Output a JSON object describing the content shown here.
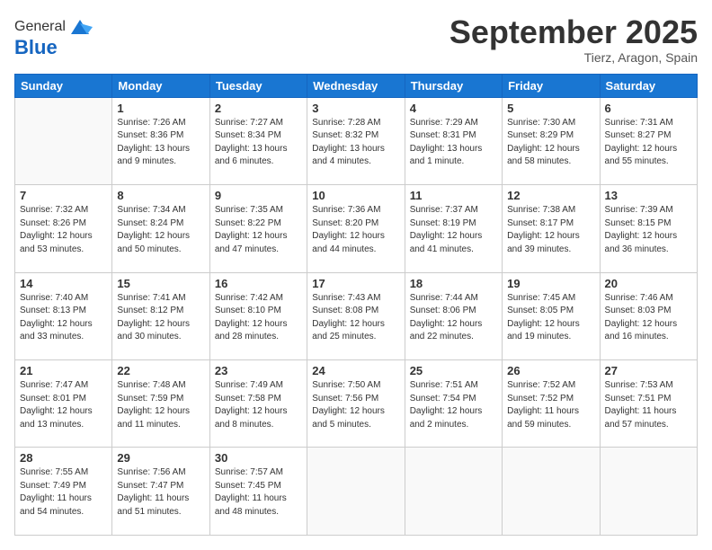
{
  "logo": {
    "general": "General",
    "blue": "Blue"
  },
  "header": {
    "month": "September 2025",
    "location": "Tierz, Aragon, Spain"
  },
  "days_of_week": [
    "Sunday",
    "Monday",
    "Tuesday",
    "Wednesday",
    "Thursday",
    "Friday",
    "Saturday"
  ],
  "weeks": [
    [
      {
        "day": "",
        "sunrise": "",
        "sunset": "",
        "daylight": ""
      },
      {
        "day": "1",
        "sunrise": "Sunrise: 7:26 AM",
        "sunset": "Sunset: 8:36 PM",
        "daylight": "Daylight: 13 hours and 9 minutes."
      },
      {
        "day": "2",
        "sunrise": "Sunrise: 7:27 AM",
        "sunset": "Sunset: 8:34 PM",
        "daylight": "Daylight: 13 hours and 6 minutes."
      },
      {
        "day": "3",
        "sunrise": "Sunrise: 7:28 AM",
        "sunset": "Sunset: 8:32 PM",
        "daylight": "Daylight: 13 hours and 4 minutes."
      },
      {
        "day": "4",
        "sunrise": "Sunrise: 7:29 AM",
        "sunset": "Sunset: 8:31 PM",
        "daylight": "Daylight: 13 hours and 1 minute."
      },
      {
        "day": "5",
        "sunrise": "Sunrise: 7:30 AM",
        "sunset": "Sunset: 8:29 PM",
        "daylight": "Daylight: 12 hours and 58 minutes."
      },
      {
        "day": "6",
        "sunrise": "Sunrise: 7:31 AM",
        "sunset": "Sunset: 8:27 PM",
        "daylight": "Daylight: 12 hours and 55 minutes."
      }
    ],
    [
      {
        "day": "7",
        "sunrise": "Sunrise: 7:32 AM",
        "sunset": "Sunset: 8:26 PM",
        "daylight": "Daylight: 12 hours and 53 minutes."
      },
      {
        "day": "8",
        "sunrise": "Sunrise: 7:34 AM",
        "sunset": "Sunset: 8:24 PM",
        "daylight": "Daylight: 12 hours and 50 minutes."
      },
      {
        "day": "9",
        "sunrise": "Sunrise: 7:35 AM",
        "sunset": "Sunset: 8:22 PM",
        "daylight": "Daylight: 12 hours and 47 minutes."
      },
      {
        "day": "10",
        "sunrise": "Sunrise: 7:36 AM",
        "sunset": "Sunset: 8:20 PM",
        "daylight": "Daylight: 12 hours and 44 minutes."
      },
      {
        "day": "11",
        "sunrise": "Sunrise: 7:37 AM",
        "sunset": "Sunset: 8:19 PM",
        "daylight": "Daylight: 12 hours and 41 minutes."
      },
      {
        "day": "12",
        "sunrise": "Sunrise: 7:38 AM",
        "sunset": "Sunset: 8:17 PM",
        "daylight": "Daylight: 12 hours and 39 minutes."
      },
      {
        "day": "13",
        "sunrise": "Sunrise: 7:39 AM",
        "sunset": "Sunset: 8:15 PM",
        "daylight": "Daylight: 12 hours and 36 minutes."
      }
    ],
    [
      {
        "day": "14",
        "sunrise": "Sunrise: 7:40 AM",
        "sunset": "Sunset: 8:13 PM",
        "daylight": "Daylight: 12 hours and 33 minutes."
      },
      {
        "day": "15",
        "sunrise": "Sunrise: 7:41 AM",
        "sunset": "Sunset: 8:12 PM",
        "daylight": "Daylight: 12 hours and 30 minutes."
      },
      {
        "day": "16",
        "sunrise": "Sunrise: 7:42 AM",
        "sunset": "Sunset: 8:10 PM",
        "daylight": "Daylight: 12 hours and 28 minutes."
      },
      {
        "day": "17",
        "sunrise": "Sunrise: 7:43 AM",
        "sunset": "Sunset: 8:08 PM",
        "daylight": "Daylight: 12 hours and 25 minutes."
      },
      {
        "day": "18",
        "sunrise": "Sunrise: 7:44 AM",
        "sunset": "Sunset: 8:06 PM",
        "daylight": "Daylight: 12 hours and 22 minutes."
      },
      {
        "day": "19",
        "sunrise": "Sunrise: 7:45 AM",
        "sunset": "Sunset: 8:05 PM",
        "daylight": "Daylight: 12 hours and 19 minutes."
      },
      {
        "day": "20",
        "sunrise": "Sunrise: 7:46 AM",
        "sunset": "Sunset: 8:03 PM",
        "daylight": "Daylight: 12 hours and 16 minutes."
      }
    ],
    [
      {
        "day": "21",
        "sunrise": "Sunrise: 7:47 AM",
        "sunset": "Sunset: 8:01 PM",
        "daylight": "Daylight: 12 hours and 13 minutes."
      },
      {
        "day": "22",
        "sunrise": "Sunrise: 7:48 AM",
        "sunset": "Sunset: 7:59 PM",
        "daylight": "Daylight: 12 hours and 11 minutes."
      },
      {
        "day": "23",
        "sunrise": "Sunrise: 7:49 AM",
        "sunset": "Sunset: 7:58 PM",
        "daylight": "Daylight: 12 hours and 8 minutes."
      },
      {
        "day": "24",
        "sunrise": "Sunrise: 7:50 AM",
        "sunset": "Sunset: 7:56 PM",
        "daylight": "Daylight: 12 hours and 5 minutes."
      },
      {
        "day": "25",
        "sunrise": "Sunrise: 7:51 AM",
        "sunset": "Sunset: 7:54 PM",
        "daylight": "Daylight: 12 hours and 2 minutes."
      },
      {
        "day": "26",
        "sunrise": "Sunrise: 7:52 AM",
        "sunset": "Sunset: 7:52 PM",
        "daylight": "Daylight: 11 hours and 59 minutes."
      },
      {
        "day": "27",
        "sunrise": "Sunrise: 7:53 AM",
        "sunset": "Sunset: 7:51 PM",
        "daylight": "Daylight: 11 hours and 57 minutes."
      }
    ],
    [
      {
        "day": "28",
        "sunrise": "Sunrise: 7:55 AM",
        "sunset": "Sunset: 7:49 PM",
        "daylight": "Daylight: 11 hours and 54 minutes."
      },
      {
        "day": "29",
        "sunrise": "Sunrise: 7:56 AM",
        "sunset": "Sunset: 7:47 PM",
        "daylight": "Daylight: 11 hours and 51 minutes."
      },
      {
        "day": "30",
        "sunrise": "Sunrise: 7:57 AM",
        "sunset": "Sunset: 7:45 PM",
        "daylight": "Daylight: 11 hours and 48 minutes."
      },
      {
        "day": "",
        "sunrise": "",
        "sunset": "",
        "daylight": ""
      },
      {
        "day": "",
        "sunrise": "",
        "sunset": "",
        "daylight": ""
      },
      {
        "day": "",
        "sunrise": "",
        "sunset": "",
        "daylight": ""
      },
      {
        "day": "",
        "sunrise": "",
        "sunset": "",
        "daylight": ""
      }
    ]
  ]
}
